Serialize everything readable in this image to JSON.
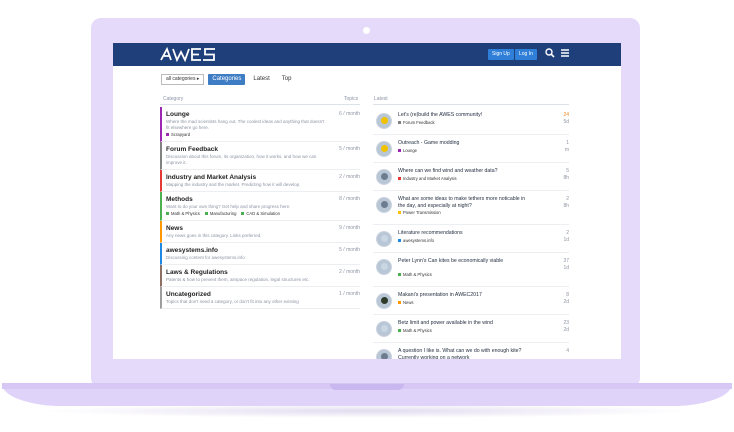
{
  "header": {
    "logo_text": "AWES",
    "signup_label": "Sign Up",
    "login_label": "Log In"
  },
  "nav": {
    "categories_dropdown": "all categories",
    "tabs": [
      {
        "label": "Categories",
        "active": true
      },
      {
        "label": "Latest",
        "active": false
      },
      {
        "label": "Top",
        "active": false
      }
    ]
  },
  "columns": {
    "category": "Category",
    "topics": "Topics",
    "latest": "Latest"
  },
  "categories": [
    {
      "name": "Lounge",
      "desc": "Where the mad scientists hang out. The coolest ideas and anything that doesn't fit elsewhere go here.",
      "per": "6 / month",
      "color": "#9c27b0",
      "subs": [
        {
          "name": "Scrapyard",
          "color": "#9c27b0"
        }
      ]
    },
    {
      "name": "Forum Feedback",
      "desc": "Discussion about this forum, its organization, how it works, and how we can improve it.",
      "per": "5 / month",
      "color": "#808281",
      "subs": []
    },
    {
      "name": "Industry and Market Analysis",
      "desc": "Mapping the industry and the market. Predicting how it will develop.",
      "per": "2 / month",
      "color": "#e53935",
      "subs": []
    },
    {
      "name": "Methods",
      "desc": "Want to do your own thing? Get help and share progress here.",
      "per": "8 / month",
      "color": "#4caf50",
      "subs": [
        {
          "name": "Math & Physics",
          "color": "#4caf50"
        },
        {
          "name": "Manufacturing",
          "color": "#4caf50"
        },
        {
          "name": "CAD & Simulation",
          "color": "#4caf50"
        }
      ]
    },
    {
      "name": "News",
      "desc": "Any news goes in this category. Links preferred.",
      "per": "9 / month",
      "color": "#ff9800",
      "subs": []
    },
    {
      "name": "awesystems.info",
      "desc": "Discussing content for awesystems.info",
      "per": "5 / month",
      "color": "#1e88e5",
      "subs": []
    },
    {
      "name": "Laws & Regulations",
      "desc": "Patents & how to prevent them, airspace regulation, legal structures etc.",
      "per": "2 / month",
      "color": "#8d6e63",
      "subs": []
    },
    {
      "name": "Uncategorized",
      "desc": "Topics that don't need a category, or don't fit into any other existing",
      "per": "1 / month",
      "color": "#9e9e9e",
      "subs": []
    }
  ],
  "topics": [
    {
      "title": "Let's (re)build the AWES community!",
      "tag": "Forum Feedback",
      "tag_color": "#808281",
      "count": "24",
      "age": "5d",
      "hot": true,
      "avatar_color": "#f2c200"
    },
    {
      "title": "Outreach - Game modding",
      "tag": "Lounge",
      "tag_color": "#9c27b0",
      "count": "1",
      "age": "m",
      "hot": false,
      "avatar_color": "#f2c200"
    },
    {
      "title": "Where can we find wind and weather data?",
      "tag": "Industry and Market Analysis",
      "tag_color": "#e53935",
      "count": "5",
      "age": "8h",
      "hot": false,
      "avatar_color": "#6d7d90"
    },
    {
      "title": "What are some ideas to make tethers more noticable in the day, and especially at night?",
      "tag": "Power Transmission",
      "tag_color": "#ffc107",
      "count": "2",
      "age": "8h",
      "hot": false,
      "avatar_color": "#6d7d90"
    },
    {
      "title": "Literature recommendations",
      "tag": "awesystems.info",
      "tag_color": "#1e88e5",
      "count": "2",
      "age": "1d",
      "hot": false,
      "avatar_color": "#c9d6e3"
    },
    {
      "title": "Peter Lynn's Can kites be economically viable",
      "tag": "Math & Physics",
      "tag_color": "#4caf50",
      "count": "37",
      "age": "1d",
      "hot": false,
      "avatar_color": "#c9d6e3"
    },
    {
      "title": "Makani's presentation in AWEC2017",
      "tag": "News",
      "tag_color": "#ff9800",
      "count": "8",
      "age": "2d",
      "hot": false,
      "avatar_color": "#2d3b28"
    },
    {
      "title": "Betz limit and power available in the wind",
      "tag": "Math & Physics",
      "tag_color": "#4caf50",
      "count": "23",
      "age": "2d",
      "hot": false,
      "avatar_color": "#c9d6e3"
    },
    {
      "title": "A question I like is. What can we do with enough kite? Currently working on a network",
      "tag": "",
      "tag_color": "#9e9e9e",
      "count": "4",
      "age": "",
      "hot": false,
      "avatar_color": "#6d7d90"
    }
  ]
}
